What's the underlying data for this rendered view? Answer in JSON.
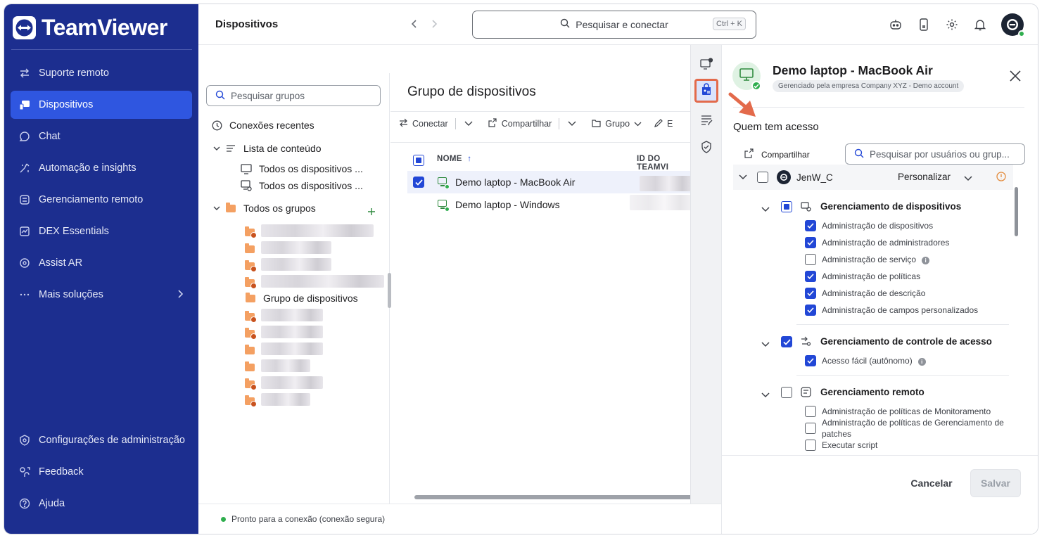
{
  "app": {
    "brand": "TeamViewer",
    "page_title": "Dispositivos"
  },
  "sidebar": {
    "items": [
      {
        "label": "Suporte remoto",
        "icon": "arrows-swap-icon"
      },
      {
        "label": "Dispositivos",
        "icon": "devices-icon",
        "active": true
      },
      {
        "label": "Chat",
        "icon": "chat-icon"
      },
      {
        "label": "Automação e insights",
        "icon": "automation-icon"
      },
      {
        "label": "Gerenciamento remoto",
        "icon": "remote-management-icon"
      },
      {
        "label": "DEX Essentials",
        "icon": "dex-icon"
      },
      {
        "label": "Assist AR",
        "icon": "assist-ar-icon"
      },
      {
        "label": "Mais soluções",
        "icon": "more-icon"
      }
    ],
    "bottom": [
      {
        "label": "Configurações de administração",
        "icon": "admin-settings-icon"
      },
      {
        "label": "Feedback",
        "icon": "feedback-icon"
      },
      {
        "label": "Ajuda",
        "icon": "help-icon"
      }
    ]
  },
  "header": {
    "search_placeholder": "Pesquisar e conectar",
    "shortcut": "Ctrl + K"
  },
  "groups": {
    "search_placeholder": "Pesquisar grupos",
    "recent": "Conexões recentes",
    "content_list": "Lista de conteúdo",
    "all_devices_1": "Todos os dispositivos ...",
    "all_devices_2": "Todos os dispositivos ...",
    "all_groups": "Todos os grupos",
    "device_group": "Grupo de dispositivos"
  },
  "device_list": {
    "title": "Grupo de dispositivos",
    "toolbar": {
      "connect": "Conectar",
      "share": "Compartilhar",
      "group": "Grupo",
      "edit": "E"
    },
    "columns": {
      "name": "NOME",
      "id": "ID DO TEAMVI"
    },
    "rows": [
      {
        "name": "Demo laptop - MacBook Air",
        "selected": true
      },
      {
        "name": "Demo laptop - Windows",
        "selected": false
      }
    ]
  },
  "status": {
    "text": "Pronto para a conexão (conexão segura)"
  },
  "panel": {
    "title": "Demo laptop - MacBook Air",
    "badge": "Gerenciado pela empresa Company XYZ - Demo account",
    "heading": "Quem tem acesso",
    "share": "Compartilhar",
    "search_placeholder": "Pesquisar por usuários ou grup...",
    "user": {
      "name": "JenW_C",
      "role": "Personalizar"
    },
    "sections": [
      {
        "title": "Gerenciamento de dispositivos",
        "state": "partial",
        "items": [
          {
            "label": "Administração de dispositivos",
            "checked": true
          },
          {
            "label": "Administração de administradores",
            "checked": true
          },
          {
            "label": "Administração de serviço",
            "checked": false
          },
          {
            "label": "Administração de políticas",
            "checked": true
          },
          {
            "label": "Administração de descrição",
            "checked": true
          },
          {
            "label": "Administração de campos personalizados",
            "checked": true
          }
        ]
      },
      {
        "title": "Gerenciamento de controle de acesso",
        "state": "checked",
        "items": [
          {
            "label": "Acesso fácil (autônomo)",
            "checked": true
          }
        ]
      },
      {
        "title": "Gerenciamento remoto",
        "state": "unchecked",
        "items": [
          {
            "label": "Administração de políticas de Monitoramento",
            "checked": false
          },
          {
            "label": "Administração de políticas de Gerenciamento de",
            "checked": false
          },
          {
            "label": "patches",
            "checked": false
          },
          {
            "label": "Executar script",
            "checked": false
          }
        ]
      }
    ],
    "cancel": "Cancelar",
    "save": "Salvar"
  },
  "colors": {
    "sidebar": "#1c2e8f",
    "active": "#2f56e0",
    "accent": "#2247d6",
    "highlight": "#e36a4b",
    "online": "#2fae4e"
  }
}
